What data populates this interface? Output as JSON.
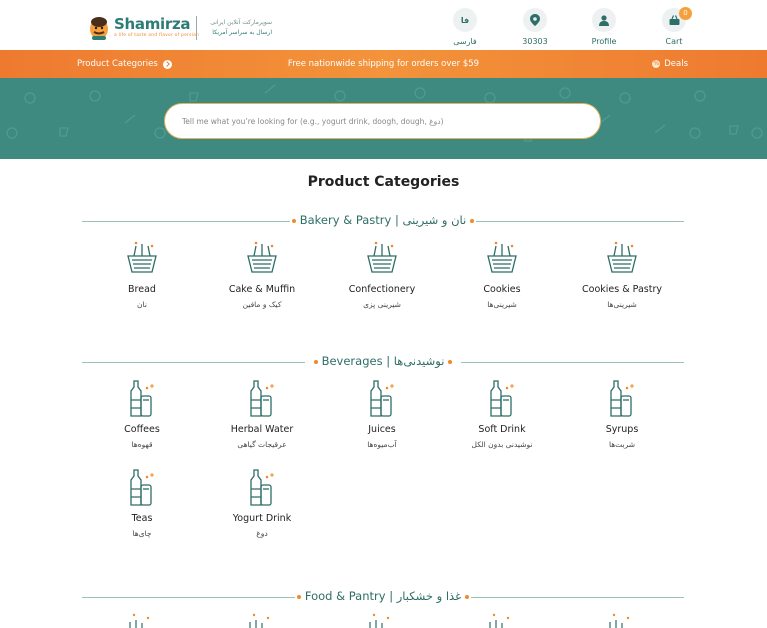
{
  "header": {
    "brand": "Shamirza",
    "brand_tagline": "a life of taste and flavor of persian",
    "brand_fa_line1": "سوپرمارکت آنلاین ایرانی",
    "brand_fa_line2": "ارسال به سراسر آمریکا",
    "nav": {
      "language": {
        "icon_text": "فا",
        "label": "فارسی"
      },
      "location": {
        "label": "30303"
      },
      "profile": {
        "label": "Profile"
      },
      "cart": {
        "label": "Cart",
        "count": "0"
      }
    }
  },
  "promo_bar": {
    "categories_label": "Product Categories",
    "shipping_text": "Free nationwide shipping for orders over $59",
    "deals_label": "Deals"
  },
  "search": {
    "placeholder": "Tell me what you’re looking for (e.g., yogurt drink, doogh, dough, دوغ)"
  },
  "main": {
    "title": "Product Categories",
    "sections": [
      {
        "title": "Bakery & Pastry | نان و شیرینی",
        "items": [
          {
            "en": "Bread",
            "fa": "نان"
          },
          {
            "en": "Cake & Muffin",
            "fa": "کیک و مافین"
          },
          {
            "en": "Confectionery",
            "fa": "شیرینی پزی"
          },
          {
            "en": "Cookies",
            "fa": "شیرینی‌ها"
          },
          {
            "en": "Cookies & Pastry",
            "fa": "شیرینی‌ها"
          }
        ]
      },
      {
        "title": "Beverages | نوشیدنی‌ها",
        "items": [
          {
            "en": "Coffees",
            "fa": "قهوه‌ها"
          },
          {
            "en": "Herbal Water",
            "fa": "عرقیجات گیاهی"
          },
          {
            "en": "Juices",
            "fa": "آب‌میوه‌ها"
          },
          {
            "en": "Soft Drink",
            "fa": "نوشیدنی بدون الکل"
          },
          {
            "en": "Syrups",
            "fa": "شربت‌ها"
          },
          {
            "en": "Teas",
            "fa": "چای‌ها"
          },
          {
            "en": "Yogurt Drink",
            "fa": "دوغ"
          }
        ]
      },
      {
        "title": "Food & Pantry | غذا و خشکبار",
        "items": []
      }
    ]
  },
  "colors": {
    "teal": "#3e8a80",
    "orange": "#ee7a30",
    "accent": "#f08a2a"
  }
}
